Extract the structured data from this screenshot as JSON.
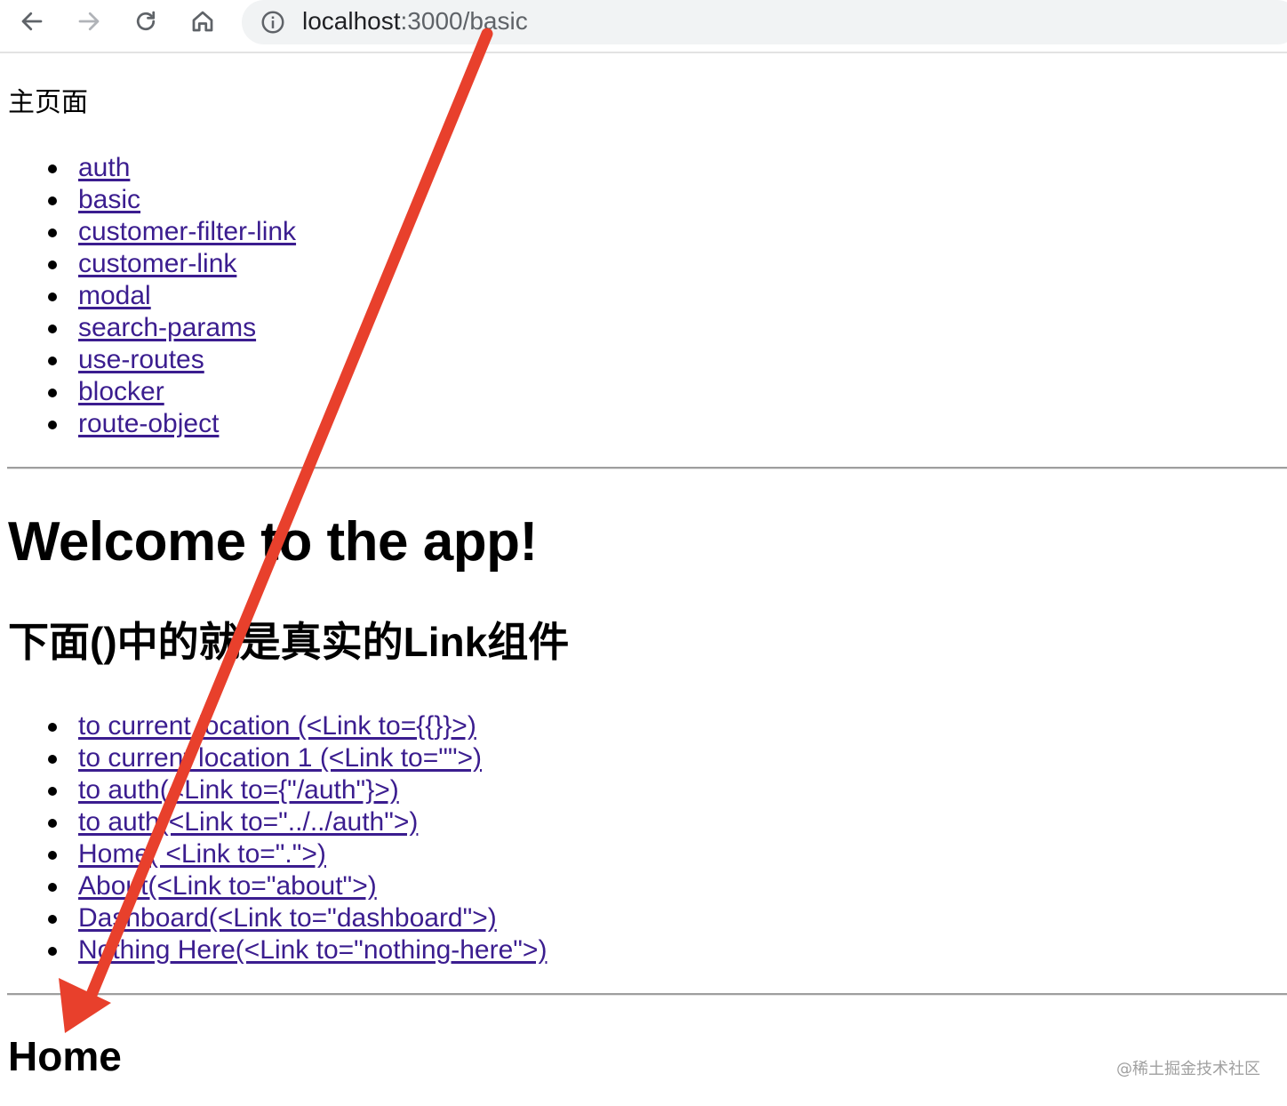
{
  "browser": {
    "url_host": "localhost",
    "url_path": ":3000/basic",
    "icons": [
      "back-arrow-icon",
      "forward-arrow-icon",
      "reload-icon",
      "home-icon",
      "info-icon"
    ]
  },
  "page": {
    "main_title": "主页面",
    "nav_links": [
      "auth",
      "basic",
      "customer-filter-link",
      "customer-link",
      "modal",
      "search-params",
      "use-routes",
      "blocker",
      "route-object"
    ],
    "heading": "Welcome to the app!",
    "subheading": "下面()中的就是真实的Link组件",
    "demo_links": [
      "to current location (<Link to={{}}>)",
      "to current location 1 (<Link to=\"\">)",
      "to auth(<Link to={\"/auth\"}>)",
      "to auth(<Link to=\"../../auth\">)",
      "Home( <Link to=\".\">)",
      "About(<Link to=\"about\">)",
      "Dashboard(<Link to=\"dashboard\">)",
      "Nothing Here(<Link to=\"nothing-here\">)"
    ],
    "outlet_heading": "Home"
  },
  "watermark": "@稀土掘金技术社区",
  "colors": {
    "link": "#3b1d8f",
    "annotation_arrow": "#e8402c",
    "omnibox_bg": "#f1f3f4"
  }
}
